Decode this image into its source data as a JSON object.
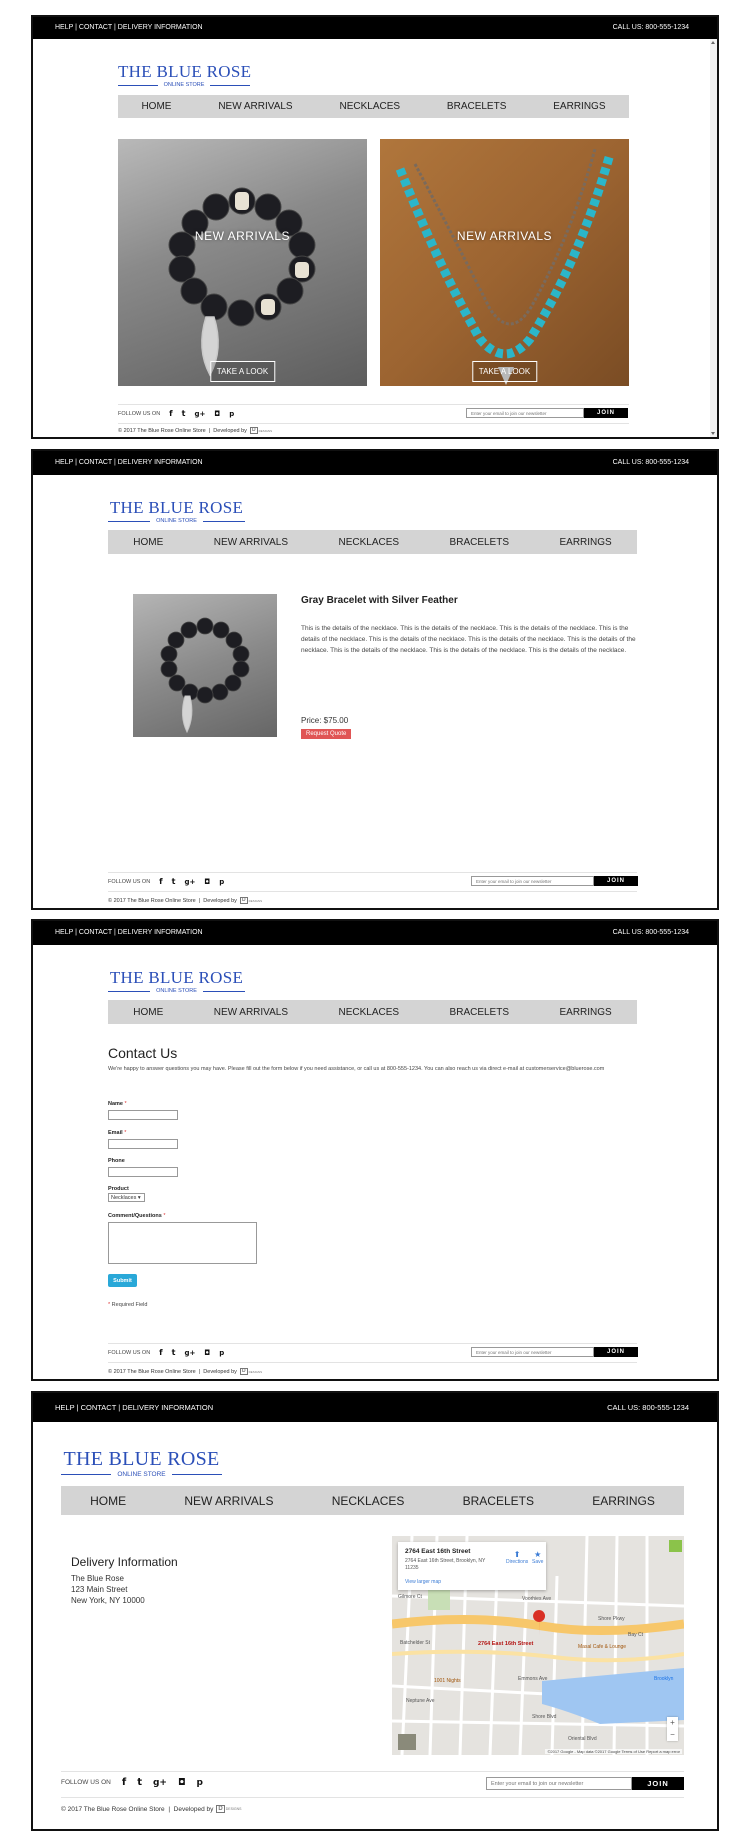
{
  "topbar": {
    "links": [
      "HELP",
      "CONTACT",
      "DELIVERY INFORMATION"
    ],
    "separator": " | ",
    "call": "CALL US: 800-555-1234"
  },
  "logo": {
    "name": "THE BLUE ROSE",
    "sub": "ONLINE STORE"
  },
  "nav": [
    "HOME",
    "NEW ARRIVALS",
    "NECKLACES",
    "BRACELETS",
    "EARRINGS"
  ],
  "home": {
    "tiles": [
      {
        "label": "NEW ARRIVALS",
        "button": "TAKE A LOOK"
      },
      {
        "label": "NEW ARRIVALS",
        "button": "TAKE A LOOK"
      }
    ]
  },
  "product": {
    "title": "Gray Bracelet with Silver Feather",
    "description": "This is the details of the necklace. This is the details of the necklace. This is the details of the necklace. This is the details of the necklace. This is the details of the necklace. This is the details of the necklace. This is the details of the necklace. This is the details of the necklace. This is the details of the necklace. This is the details of the necklace.",
    "price": "Price: $75.00",
    "button": "Request Quote"
  },
  "contact": {
    "title": "Contact Us",
    "intro": "We're happy to answer questions you may have. Please fill out the form below if you need assistance, or call us at 800-555-1234. You can also reach us via direct e-mail at customerservice@bluerose.com",
    "fields": {
      "name": "Name",
      "email": "Email",
      "phone": "Phone",
      "product": "Product",
      "comments": "Comment/Questions"
    },
    "required_mark": "*",
    "product_selected": "Necklaces",
    "submit": "Submit",
    "required_note": "Required Field"
  },
  "delivery": {
    "title": "Delivery Information",
    "address": [
      "The Blue Rose",
      "123 Main Street",
      "New York, NY 10000"
    ]
  },
  "map": {
    "card_title": "2764 East 16th Street",
    "card_address": "2764 East 16th Street, Brooklyn, NY 11235",
    "directions": "Directions",
    "save": "Save",
    "larger": "View larger map",
    "pin_label": "2764 East 16th Street",
    "places": [
      "Shore Pkwy",
      "Masal Cafe & Lounge",
      "1001 Nights",
      "Emmons Ave",
      "Brooklyn",
      "Voorhies Ave",
      "Gilmore Ct",
      "Batchelder St",
      "Shore Blvd",
      "Neptune Ave",
      "Bay Ct",
      "Oriental Blvd"
    ],
    "credits": "©2017 Google - Map data ©2017 Google   Terms of Use   Report a map error"
  },
  "footer": {
    "follow": "FOLLOW US ON",
    "social_icons": [
      "facebook-icon",
      "twitter-icon",
      "google-plus-icon",
      "instagram-icon",
      "pinterest-icon"
    ],
    "newsletter_placeholder": "Enter your email to join our newsletter",
    "join": "JOIN",
    "copyright": "© 2017 The Blue Rose Online Store",
    "sep": "|",
    "developed": "Developed by",
    "dev_text": "DESIGNS"
  },
  "colors": {
    "brand_blue": "#2b4fb8",
    "nav_bg": "#d4d4d4",
    "topbar_bg": "#000000",
    "quote_red": "#e05555",
    "submit_blue": "#29a8d8"
  }
}
